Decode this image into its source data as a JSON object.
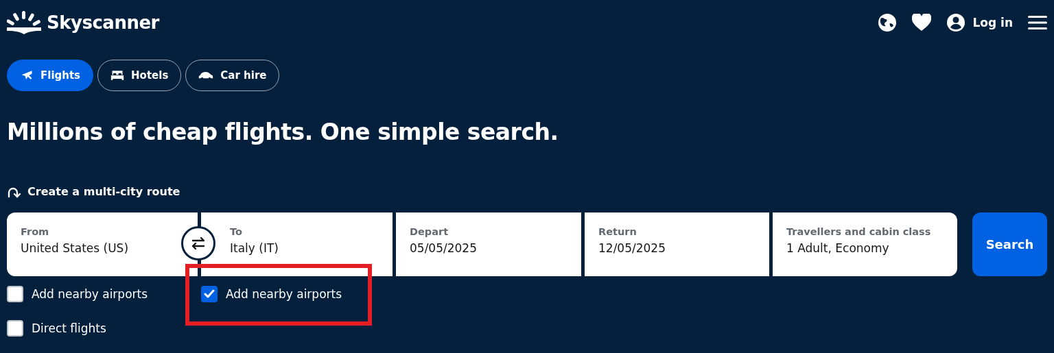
{
  "header": {
    "logo": "Skyscanner",
    "login": "Log in"
  },
  "tabs": [
    {
      "label": "Flights",
      "selected": true,
      "kind": "plane"
    },
    {
      "label": "Hotels",
      "selected": false,
      "kind": "bed"
    },
    {
      "label": "Car hire",
      "selected": false,
      "kind": "car"
    }
  ],
  "headline": "Millions of cheap flights. One simple search.",
  "multi_city": "Create a multi-city route",
  "fields": [
    {
      "label": "From",
      "value": "United States (US)"
    },
    {
      "label": "To",
      "value": "Italy (IT)"
    },
    {
      "label": "Depart",
      "value": "05/05/2025"
    },
    {
      "label": "Return",
      "value": "12/05/2025"
    },
    {
      "label": "Travellers and cabin class",
      "value": "1 Adult, Economy"
    }
  ],
  "search_button": "Search",
  "options": [
    {
      "label": "Add nearby airports",
      "checked": false,
      "highlighted": false
    },
    {
      "label": "Add nearby airports",
      "checked": true,
      "highlighted": true
    },
    {
      "label": "Direct flights",
      "checked": false,
      "highlighted": false
    }
  ]
}
